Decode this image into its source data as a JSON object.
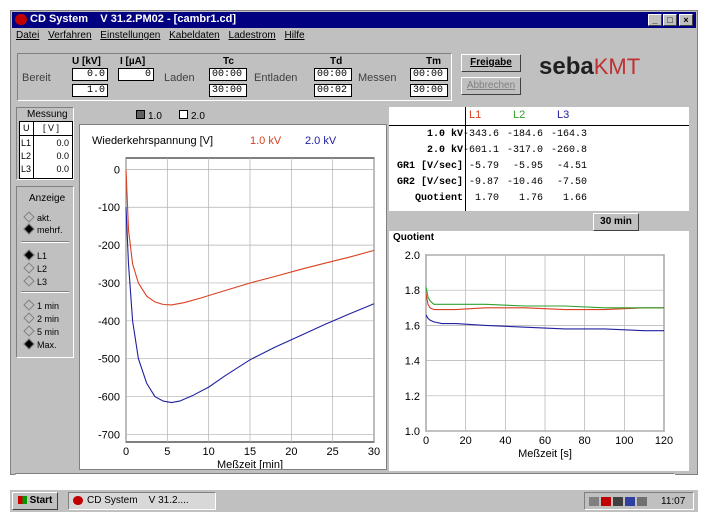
{
  "title": "CD System    V 31.2.PM02 - [cambr1.cd]",
  "window_buttons": {
    "min": "_",
    "max": "□",
    "close": "×"
  },
  "menu": [
    "Datei",
    "Verfahren",
    "Einstellungen",
    "Kabeldaten",
    "Ladestrom",
    "Hilfe"
  ],
  "status": {
    "bereit": "Bereit",
    "laden": "Laden",
    "entladen": "Entladen",
    "messen": "Messen",
    "u_label": "U [kV]",
    "u_value1": "0.0",
    "u_value2": "1.0",
    "i_label": "I [µA]",
    "i_value": "0",
    "tc_label": "Tc",
    "tc_value1": "00:00",
    "tc_value2": "30:00",
    "td_label": "Td",
    "td_value1": "00:00",
    "td_value2": "00:02",
    "tm_label": "Tm",
    "tm_value1": "00:00",
    "tm_value2": "30:00",
    "freigabe": "Freigabe",
    "abbrechen": "Abbrechen",
    "logo_seba": "seba",
    "logo_kmt": "KMT"
  },
  "messung": {
    "title": "Messung",
    "col_u": "U",
    "col_unit": "[ V ]",
    "rows": [
      {
        "l": "L1",
        "v": "0.0"
      },
      {
        "l": "L2",
        "v": "0.0"
      },
      {
        "l": "L3",
        "v": "0.0"
      }
    ]
  },
  "anzeige": {
    "title": "Anzeige",
    "mode": [
      "akt.",
      "mehrf."
    ],
    "lines": [
      "L1",
      "L2",
      "L3"
    ],
    "times": [
      "1 min",
      "2 min",
      "5 min",
      "Max."
    ]
  },
  "legend_boxes": {
    "a": "1.0",
    "b": "2.0"
  },
  "left_chart_labels": {
    "title": "Wiederkehrspannung [V]",
    "s1": "1.0 kV",
    "s2": "2.0 kV"
  },
  "results": {
    "headers": [
      "L1",
      "L2",
      "L3"
    ],
    "rows": [
      {
        "label": "1.0 kV",
        "v": [
          "-343.6",
          "-184.6",
          "-164.3"
        ]
      },
      {
        "label": "2.0 kV",
        "v": [
          "-601.1",
          "-317.0",
          "-260.8"
        ]
      },
      {
        "label": "GR1 [V/sec]",
        "v": [
          "-5.79",
          "-5.95",
          "-4.51"
        ]
      },
      {
        "label": "GR2 [V/sec]",
        "v": [
          "-9.87",
          "-10.46",
          "-7.50"
        ]
      },
      {
        "label": "Quotient",
        "v": [
          "1.70",
          "1.76",
          "1.66"
        ]
      }
    ],
    "button": "30 min"
  },
  "right_chart_labels": {
    "title": "Quotient"
  },
  "taskbar": {
    "start": "Start",
    "task": "CD System    V 31.2....",
    "time": "11:07"
  },
  "colors": {
    "l1": "#d94020",
    "l2": "#30a030",
    "l3": "#2020a0",
    "titlebar": "#000080"
  },
  "chart_data": [
    {
      "type": "line",
      "title": "Wiederkehrspannung [V]",
      "xlabel": "Meßzeit [min]",
      "ylabel": "",
      "xlim": [
        0,
        30
      ],
      "ylim": [
        -720,
        30
      ],
      "xticks": [
        0,
        5,
        10,
        15,
        20,
        25,
        30
      ],
      "yticks": [
        0,
        -100,
        -200,
        -300,
        -400,
        -500,
        -600,
        -700
      ],
      "grid": true,
      "series": [
        {
          "name": "1.0 kV",
          "color": "#d94020",
          "x": [
            0,
            0.3,
            0.8,
            1.5,
            2.5,
            3.5,
            4.5,
            5.5,
            7,
            9,
            12,
            15,
            18,
            21,
            24,
            27,
            30
          ],
          "y": [
            0,
            -160,
            -250,
            -300,
            -335,
            -350,
            -357,
            -358,
            -352,
            -340,
            -320,
            -300,
            -283,
            -265,
            -248,
            -232,
            -214
          ]
        },
        {
          "name": "2.0 kV",
          "color": "#2020a0",
          "x": [
            0,
            0.3,
            0.8,
            1.5,
            2.5,
            3.5,
            4.5,
            5.5,
            6.5,
            8,
            10,
            12,
            15,
            18,
            21,
            24,
            27,
            30
          ],
          "y": [
            -100,
            -250,
            -400,
            -500,
            -565,
            -600,
            -612,
            -616,
            -612,
            -598,
            -575,
            -545,
            -503,
            -470,
            -440,
            -410,
            -382,
            -355
          ]
        }
      ]
    },
    {
      "type": "line",
      "title": "Quotient",
      "xlabel": "Meßzeit [s]",
      "ylabel": "",
      "xlim": [
        0,
        120
      ],
      "ylim": [
        1.0,
        2.0
      ],
      "xticks": [
        0,
        20,
        40,
        60,
        80,
        100,
        120
      ],
      "yticks": [
        1.0,
        1.2,
        1.4,
        1.6,
        1.8,
        2.0
      ],
      "grid": true,
      "series": [
        {
          "name": "L1",
          "color": "#d94020",
          "x": [
            0,
            1,
            2,
            4,
            8,
            15,
            30,
            50,
            70,
            90,
            110,
            120
          ],
          "y": [
            1.78,
            1.72,
            1.7,
            1.69,
            1.69,
            1.69,
            1.7,
            1.7,
            1.69,
            1.69,
            1.7,
            1.7
          ]
        },
        {
          "name": "L2",
          "color": "#30a030",
          "x": [
            0,
            1,
            2,
            4,
            8,
            15,
            30,
            50,
            70,
            90,
            110,
            120
          ],
          "y": [
            1.82,
            1.76,
            1.74,
            1.72,
            1.72,
            1.72,
            1.72,
            1.71,
            1.71,
            1.7,
            1.7,
            1.7
          ]
        },
        {
          "name": "L3",
          "color": "#2020a0",
          "x": [
            0,
            1,
            2,
            4,
            8,
            15,
            30,
            50,
            70,
            90,
            110,
            120
          ],
          "y": [
            1.66,
            1.64,
            1.63,
            1.62,
            1.61,
            1.61,
            1.6,
            1.59,
            1.58,
            1.58,
            1.57,
            1.57
          ]
        }
      ]
    }
  ]
}
